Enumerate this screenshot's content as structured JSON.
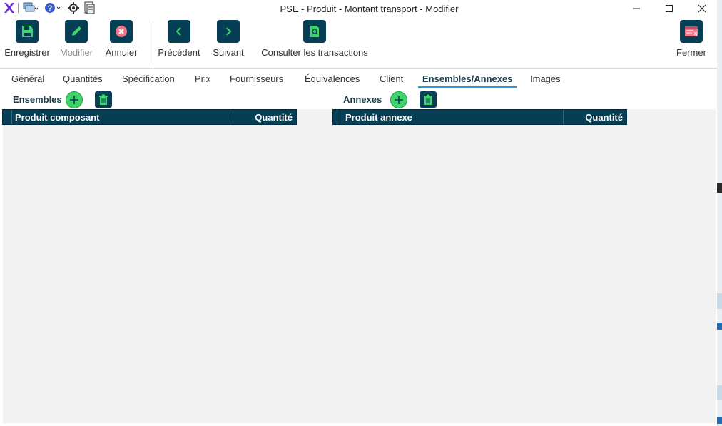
{
  "window": {
    "title": "PSE - Produit - Montant transport - Modifier",
    "minimize_icon": "minimize-icon",
    "maximize_icon": "maximize-icon",
    "close_icon": "close-icon"
  },
  "quick_access": [
    "app-logo-icon",
    "windows-icon",
    "help-icon",
    "settings-icon",
    "document-icon"
  ],
  "toolbar": {
    "save_label": "Enregistrer",
    "modify_label": "Modifier",
    "cancel_label": "Annuler",
    "previous_label": "Précédent",
    "next_label": "Suivant",
    "transactions_label": "Consulter les transactions",
    "close_label": "Fermer"
  },
  "tabs": [
    {
      "label": "Général"
    },
    {
      "label": "Quantités"
    },
    {
      "label": "Spécification"
    },
    {
      "label": "Prix"
    },
    {
      "label": "Fournisseurs"
    },
    {
      "label": "Équivalences"
    },
    {
      "label": "Client"
    },
    {
      "label": "Ensembles/Annexes",
      "active": true
    },
    {
      "label": "Images"
    }
  ],
  "ensembles": {
    "title": "Ensembles",
    "col_product": "Produit composant",
    "col_qty": "Quantité",
    "rows": []
  },
  "annexes": {
    "title": "Annexes",
    "col_product": "Produit annexe",
    "col_qty": "Quantité",
    "rows": []
  },
  "colors": {
    "header_bg": "#063f55",
    "add_green": "#3fd56b",
    "tab_accent": "#2a9bd4"
  }
}
